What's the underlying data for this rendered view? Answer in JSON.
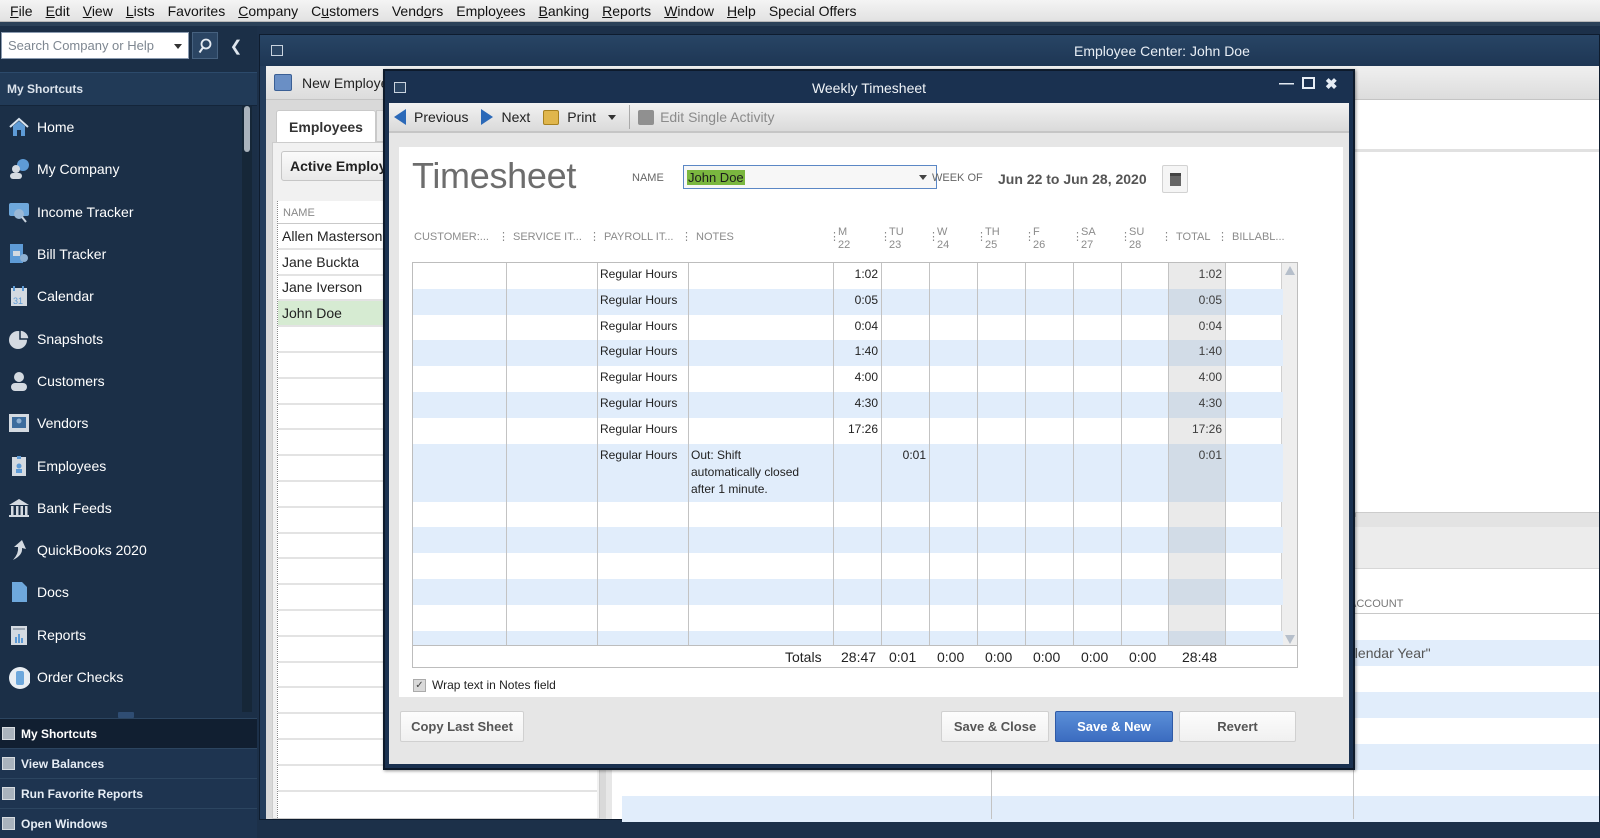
{
  "menubar": {
    "items": [
      {
        "label": "File",
        "u": "F",
        "rest": "ile"
      },
      {
        "label": "Edit",
        "u": "E",
        "rest": "dit"
      },
      {
        "label": "View",
        "u": "V",
        "rest": "iew"
      },
      {
        "label": "Lists",
        "u": "L",
        "rest": "ists"
      },
      {
        "label": "Favorites",
        "u": "",
        "rest": "Favorites"
      },
      {
        "label": "Company",
        "u": "C",
        "rest": "ompany"
      },
      {
        "label": "Customers",
        "pre": "C",
        "u": "u",
        "rest": "stomers"
      },
      {
        "label": "Vendors",
        "pre": "Vend",
        "u": "o",
        "rest": "rs"
      },
      {
        "label": "Employees",
        "pre": "Emplo",
        "u": "y",
        "rest": "ees"
      },
      {
        "label": "Banking",
        "u": "B",
        "rest": "anking"
      },
      {
        "label": "Reports",
        "u": "R",
        "rest": "eports"
      },
      {
        "label": "Window",
        "u": "W",
        "rest": "indow"
      },
      {
        "label": "Help",
        "u": "H",
        "rest": "elp"
      },
      {
        "label": "Special Offers",
        "u": "",
        "rest": "Special Offers"
      }
    ]
  },
  "sidebar": {
    "search_placeholder": "Search Company or Help",
    "section_title": "My Shortcuts",
    "items": [
      {
        "label": "Home",
        "icon": "home-icon"
      },
      {
        "label": "My Company",
        "icon": "my-company-icon"
      },
      {
        "label": "Income Tracker",
        "icon": "income-tracker-icon"
      },
      {
        "label": "Bill Tracker",
        "icon": "bill-tracker-icon"
      },
      {
        "label": "Calendar",
        "icon": "calendar-icon"
      },
      {
        "label": "Snapshots",
        "icon": "pie-chart-icon"
      },
      {
        "label": "Customers",
        "icon": "customer-icon"
      },
      {
        "label": "Vendors",
        "icon": "vendor-icon"
      },
      {
        "label": "Employees",
        "icon": "employee-badge-icon"
      },
      {
        "label": "Bank Feeds",
        "icon": "bank-icon"
      },
      {
        "label": "QuickBooks 2020",
        "icon": "upgrade-arrow-icon"
      },
      {
        "label": "Docs",
        "icon": "document-icon"
      },
      {
        "label": "Reports",
        "icon": "report-icon"
      },
      {
        "label": "Order Checks",
        "icon": "order-checks-icon"
      }
    ],
    "bottom_nav": [
      {
        "label": "My Shortcuts",
        "active": true
      },
      {
        "label": "View Balances",
        "active": false
      },
      {
        "label": "Run Favorite Reports",
        "active": false
      },
      {
        "label": "Open Windows",
        "active": false
      }
    ]
  },
  "employee_center": {
    "title": "Employee Center: John Doe",
    "new_employee_label": "New Employee...",
    "tab_label": "Employees",
    "filter_value": "Active Employees",
    "list_header": "NAME",
    "employees": [
      {
        "name": "Allen Masterson",
        "selected": false
      },
      {
        "name": "Jane Buckta",
        "selected": false
      },
      {
        "name": "Jane Iverson",
        "selected": false
      },
      {
        "name": "John Doe",
        "selected": true
      }
    ],
    "transactions_header_account": "ACCOUNT",
    "transactions_message": "There are no transactions of type \"All Transactions\" in date range \"This Calendar Year\""
  },
  "timesheet": {
    "window_title": "Weekly Timesheet",
    "toolbar": {
      "previous": "Previous",
      "next": "Next",
      "print": "Print",
      "edit_single": "Edit Single Activity"
    },
    "heading": "Timesheet",
    "name_label": "NAME",
    "name_value": "John Doe",
    "week_label": "WEEK OF",
    "week_value": "Jun 22 to Jun 28, 2020",
    "columns": {
      "customer": "CUSTOMER:...",
      "service": "SERVICE IT...",
      "payroll": "PAYROLL IT...",
      "notes": "NOTES",
      "days": [
        {
          "d": "M",
          "n": "22"
        },
        {
          "d": "TU",
          "n": "23"
        },
        {
          "d": "W",
          "n": "24"
        },
        {
          "d": "TH",
          "n": "25"
        },
        {
          "d": "F",
          "n": "26"
        },
        {
          "d": "SA",
          "n": "27"
        },
        {
          "d": "SU",
          "n": "28"
        }
      ],
      "total": "TOTAL",
      "billable": "BILLABL..."
    },
    "rows": [
      {
        "customer": "",
        "service": "",
        "payroll": "Regular Hours",
        "notes": "",
        "days": [
          "1:02",
          "",
          "",
          "",
          "",
          "",
          ""
        ],
        "total": "1:02"
      },
      {
        "customer": "",
        "service": "",
        "payroll": "Regular Hours",
        "notes": "",
        "days": [
          "0:05",
          "",
          "",
          "",
          "",
          "",
          ""
        ],
        "total": "0:05"
      },
      {
        "customer": "",
        "service": "",
        "payroll": "Regular Hours",
        "notes": "",
        "days": [
          "0:04",
          "",
          "",
          "",
          "",
          "",
          ""
        ],
        "total": "0:04"
      },
      {
        "customer": "",
        "service": "",
        "payroll": "Regular Hours",
        "notes": "",
        "days": [
          "1:40",
          "",
          "",
          "",
          "",
          "",
          ""
        ],
        "total": "1:40"
      },
      {
        "customer": "",
        "service": "",
        "payroll": "Regular Hours",
        "notes": "",
        "days": [
          "4:00",
          "",
          "",
          "",
          "",
          "",
          ""
        ],
        "total": "4:00"
      },
      {
        "customer": "",
        "service": "",
        "payroll": "Regular Hours",
        "notes": "",
        "days": [
          "4:30",
          "",
          "",
          "",
          "",
          "",
          ""
        ],
        "total": "4:30"
      },
      {
        "customer": "",
        "service": "",
        "payroll": "Regular Hours",
        "notes": "",
        "days": [
          "17:26",
          "",
          "",
          "",
          "",
          "",
          ""
        ],
        "total": "17:26"
      },
      {
        "customer": "",
        "service": "",
        "payroll": "Regular Hours",
        "notes": "Out: Shift automatically closed after 1 minute.",
        "days": [
          "",
          "0:01",
          "",
          "",
          "",
          "",
          ""
        ],
        "total": "0:01"
      }
    ],
    "totals_label": "Totals",
    "totals": [
      "28:47",
      "0:01",
      "0:00",
      "0:00",
      "0:00",
      "0:00",
      "0:00"
    ],
    "grand_total": "28:48",
    "wrap_text_label": "Wrap text in Notes field",
    "wrap_text_checked": true,
    "buttons": {
      "copy_last": "Copy Last Sheet",
      "save_close": "Save & Close",
      "save_new": "Save & New",
      "revert": "Revert"
    },
    "colors": {
      "accent": "#3b6cc0",
      "row_alt": "#e1edfb",
      "name_highlight": "#7ab73f"
    }
  }
}
